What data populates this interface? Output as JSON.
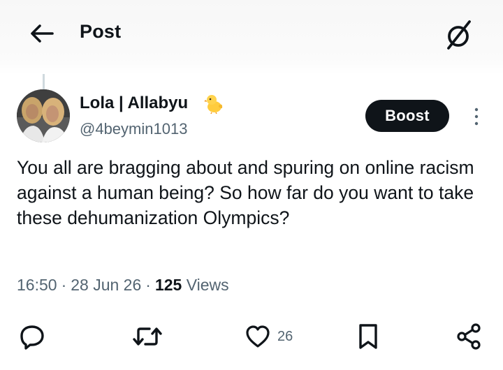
{
  "header": {
    "title": "Post"
  },
  "author": {
    "display_name": "Lola | Allabyu",
    "handle": "@4beymin1013"
  },
  "boost_label": "Boost",
  "tweet": {
    "text": "You all are bragging about and spuring on online racism against a human being? So how far do you want to take these dehumanization Olympics?"
  },
  "meta": {
    "time": "16:50",
    "date": "28 Jun 26",
    "views_count": "125",
    "views_label": "Views"
  },
  "actions": {
    "likes": "26"
  },
  "icons": {
    "back": "arrow-left-icon",
    "grok": "grok-icon",
    "badge": "baby-chick-icon",
    "more": "more-vertical-icon",
    "reply": "reply-icon",
    "retweet": "retweet-icon",
    "like": "heart-icon",
    "bookmark": "bookmark-icon",
    "share": "share-icon"
  },
  "colors": {
    "text_primary": "#0f1419",
    "text_secondary": "#536471",
    "button_bg": "#0f1419"
  }
}
